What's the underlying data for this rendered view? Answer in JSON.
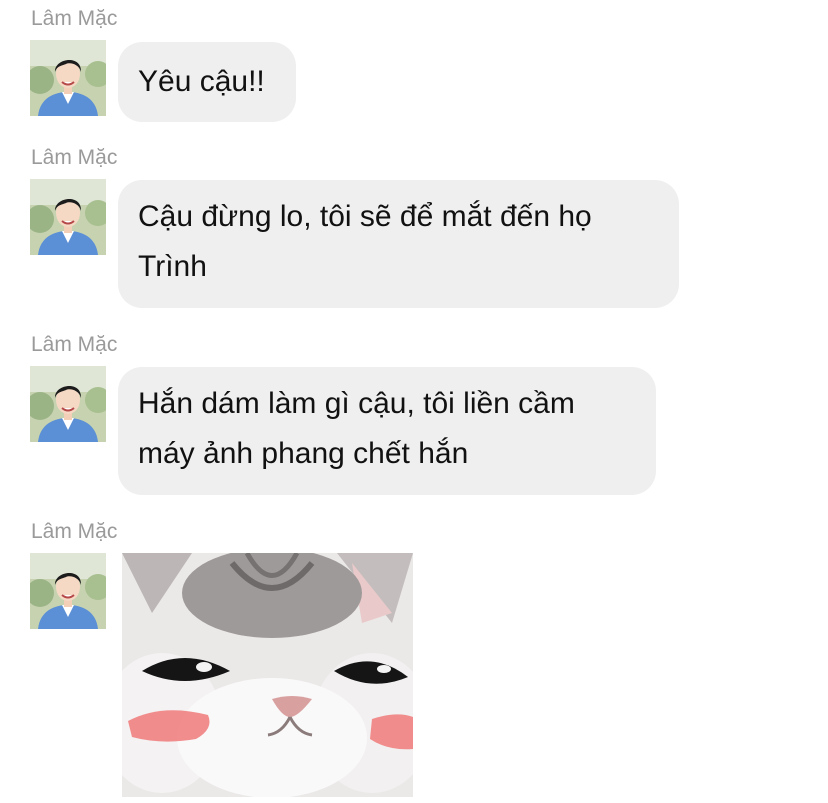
{
  "messages": [
    {
      "sender": "Lâm Mặc",
      "lines": [
        "Yêu cậu!!"
      ]
    },
    {
      "sender": "Lâm Mặc",
      "lines": [
        "Cậu đừng lo, tôi sẽ để mắt đến họ",
        "Trình"
      ]
    },
    {
      "sender": "Lâm Mặc",
      "lines": [
        "Hắn dám làm gì cậu, tôi liền cầm",
        "máy ảnh phang chết hắn"
      ]
    },
    {
      "sender": "Lâm Mặc",
      "sticker": "cute-cat-face-sticker"
    }
  ],
  "avatar_icon": "person-avatar-photo",
  "colors": {
    "bubble": "#efefef",
    "sender_text": "#9a9a9a",
    "message_text": "#111111",
    "avatar_shirt": "#5b8fd6",
    "cat_blush": "#f07a7a"
  }
}
